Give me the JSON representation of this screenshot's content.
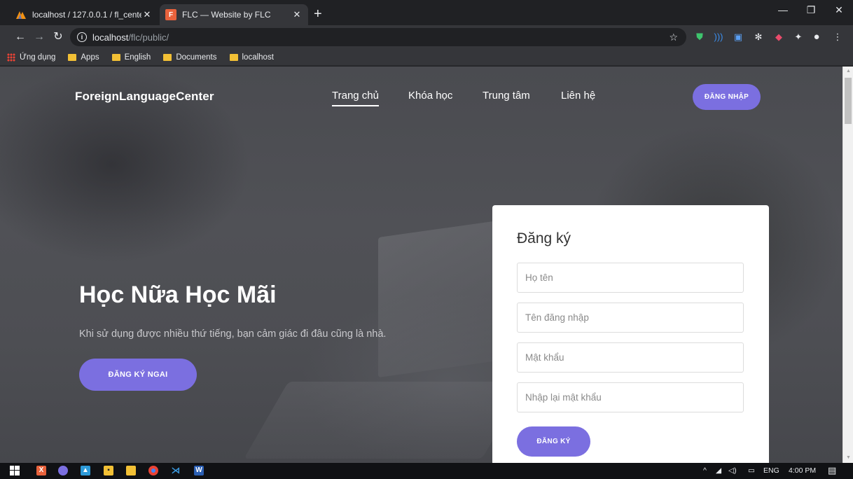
{
  "browser": {
    "tabs": [
      {
        "title": "localhost / 127.0.0.1 / fl_center / ",
        "icon": "phpmyadmin-icon"
      },
      {
        "title": "FLC — Website by FLC",
        "icon": "flc-favicon-icon"
      }
    ],
    "url_host": "localhost",
    "url_path": "/flc/public/",
    "bookmarks": [
      {
        "label": "Ứng dụng",
        "icon": "apps-grid-icon"
      },
      {
        "label": "Apps",
        "icon": "folder-icon"
      },
      {
        "label": "English",
        "icon": "folder-icon"
      },
      {
        "label": "Documents",
        "icon": "folder-icon"
      },
      {
        "label": "localhost",
        "icon": "folder-icon"
      }
    ]
  },
  "site": {
    "brand": "ForeignLanguageCenter",
    "nav": [
      "Trang chủ",
      "Khóa học",
      "Trung tâm",
      "Liên hệ"
    ],
    "login_label": "ĐĂNG NHẬP",
    "accent_color": "#7b6fe0"
  },
  "hero": {
    "title": "Học Nữa Học Mãi",
    "subtitle": "Khi sử dụng được nhiều thứ tiếng, bạn cảm giác đi đâu cũng là nhà.",
    "cta_label": "ĐĂNG KÝ NGAI"
  },
  "register_form": {
    "title": "Đăng ký",
    "fullname_placeholder": "Họ tên",
    "username_placeholder": "Tên đăng nhập",
    "password_placeholder": "Mật khẩu",
    "confirm_placeholder": "Nhập lại mật khẩu",
    "submit_label": "ĐĂNG KÝ"
  },
  "taskbar": {
    "lang": "ENG",
    "time": "4:00 PM"
  }
}
